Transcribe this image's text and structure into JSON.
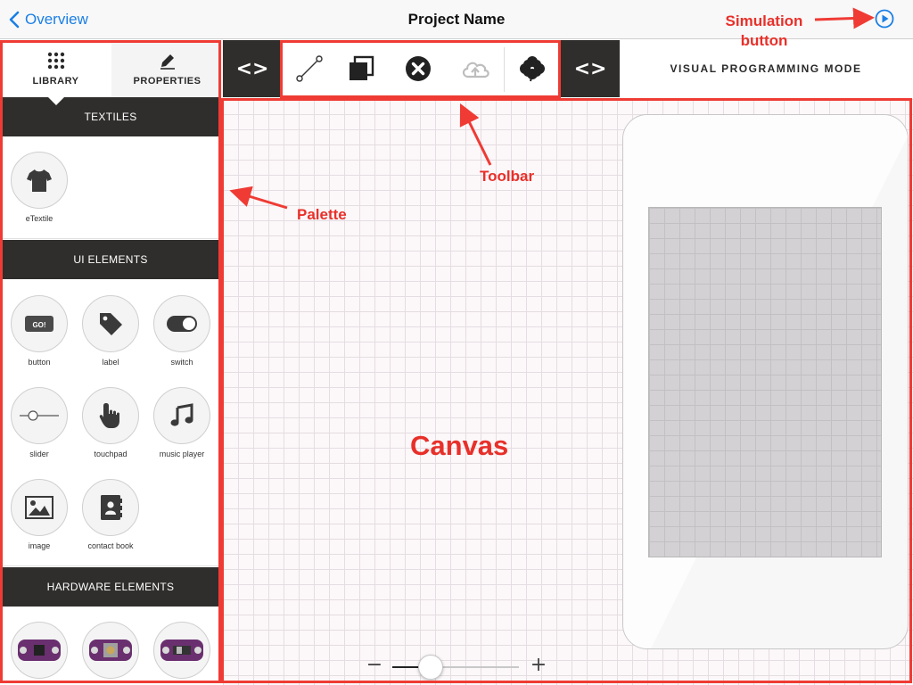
{
  "navbar": {
    "back_label": "Overview",
    "title": "Project Name",
    "simulation_icon": "play-circle-icon"
  },
  "palette_tabs": {
    "library_label": "LIBRARY",
    "library_icon": "grid-dots-icon",
    "properties_label": "PROPERTIES",
    "properties_icon": "pencil-icon"
  },
  "toolbar": {
    "code_toggle_label": "<>",
    "tools": [
      {
        "name": "connect-tool",
        "icon": "line-connector-icon"
      },
      {
        "name": "duplicate-tool",
        "icon": "overlap-squares-icon"
      },
      {
        "name": "delete-tool",
        "icon": "close-circle-icon"
      },
      {
        "name": "upload-tool",
        "icon": "cloud-upload-icon"
      },
      {
        "name": "plugin-tool",
        "icon": "clover-icon"
      }
    ],
    "mode_label": "VISUAL PROGRAMMING MODE"
  },
  "palette": {
    "sections": [
      {
        "title": "TEXTILES",
        "items": [
          {
            "label": "eTextile",
            "icon": "tshirt-icon"
          }
        ]
      },
      {
        "title": "UI ELEMENTS",
        "items": [
          {
            "label": "button",
            "icon": "go-button-icon"
          },
          {
            "label": "label",
            "icon": "tag-icon"
          },
          {
            "label": "switch",
            "icon": "toggle-icon"
          },
          {
            "label": "slider",
            "icon": "slider-icon"
          },
          {
            "label": "touchpad",
            "icon": "hand-pointer-icon"
          },
          {
            "label": "music player",
            "icon": "music-note-icon"
          },
          {
            "label": "image",
            "icon": "image-icon"
          },
          {
            "label": "contact book",
            "icon": "contact-book-icon"
          }
        ]
      },
      {
        "title": "HARDWARE ELEMENTS",
        "items": [
          {
            "label": "",
            "icon": "hardware-board-icon"
          },
          {
            "label": "",
            "icon": "hardware-button-icon"
          },
          {
            "label": "",
            "icon": "hardware-switch-icon"
          }
        ]
      }
    ]
  },
  "canvas": {
    "zoom_minus": "−",
    "zoom_plus": "+",
    "zoom_level": 0.3
  },
  "annotations": {
    "simulation": "Simulation\nbutton",
    "toolbar": "Toolbar",
    "palette": "Palette",
    "canvas": "Canvas",
    "color": "#ef3b34"
  }
}
